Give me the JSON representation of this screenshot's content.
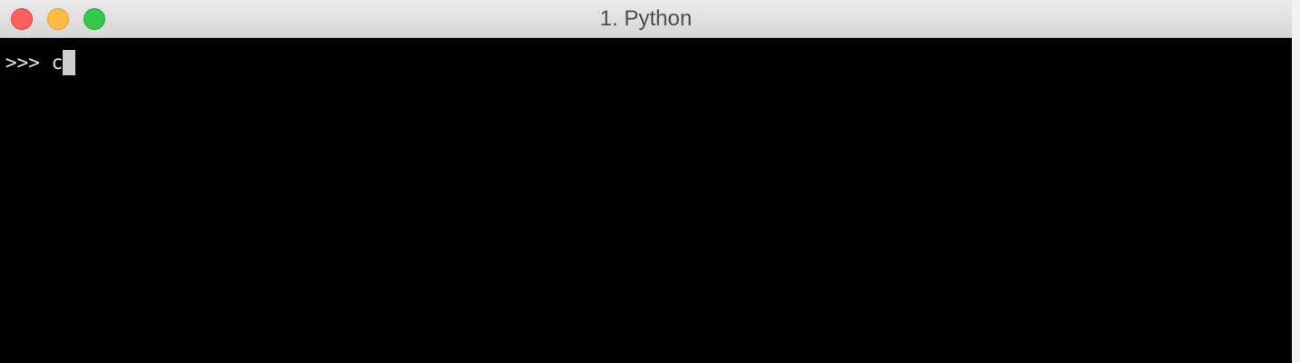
{
  "window": {
    "title": "1. Python"
  },
  "terminal": {
    "prompt": ">>> ",
    "input": "c"
  }
}
